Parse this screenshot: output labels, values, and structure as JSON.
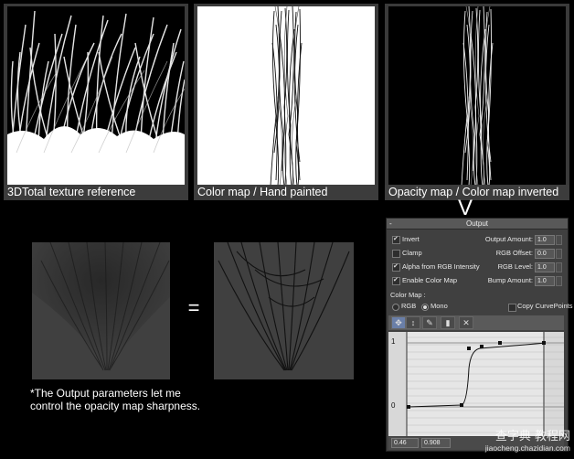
{
  "captions": {
    "thumb1": "3DTotal texture reference",
    "thumb2": "Color map / Hand painted",
    "thumb3": "Opacity map / Color map inverted"
  },
  "arrow_symbol": "V",
  "equals_symbol": "=",
  "note_line1": "*The Output parameters let me",
  "note_line2": "control the opacity map sharpness.",
  "output_panel": {
    "title": "Output",
    "collapse_symbol": "-",
    "checkboxes": [
      {
        "label": "Invert",
        "checked": true
      },
      {
        "label": "Clamp",
        "checked": false
      },
      {
        "label": "Alpha from RGB Intensity",
        "checked": true
      },
      {
        "label": "Enable Color Map",
        "checked": true
      }
    ],
    "fields": [
      {
        "label": "Output Amount:",
        "value": "1.0"
      },
      {
        "label": "RGB Offset:",
        "value": "0.0"
      },
      {
        "label": "RGB Level:",
        "value": "1.0"
      },
      {
        "label": "Bump Amount:",
        "value": "1.0"
      }
    ],
    "color_map_label": "Color Map :",
    "rgb_label": "RGB",
    "mono_label": "Mono",
    "mode_selected": "Mono",
    "copy_curve_label": "Copy CurvePoints",
    "copy_curve_checked": false,
    "graph_label_top": "1",
    "graph_label_bottom": "0",
    "status_x": "0.46",
    "status_y": "0.908"
  },
  "watermark_line1": "查字典 教程网",
  "watermark_line2": "jiaocheng.chazidian.com"
}
